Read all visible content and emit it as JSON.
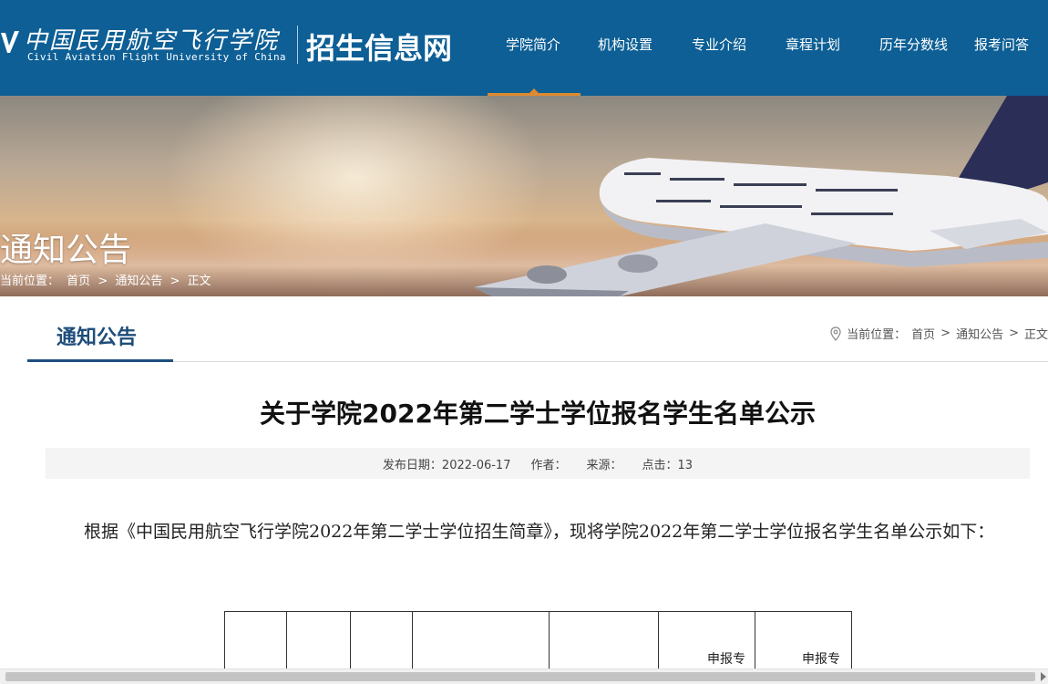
{
  "header": {
    "logo_cn": "中国民用航空飞行学院",
    "logo_en": "Civil Aviation Flight University of China",
    "site_title": "招生信息网",
    "nav": [
      {
        "label": "学院简介",
        "active": true
      },
      {
        "label": "机构设置",
        "active": false
      },
      {
        "label": "专业介绍",
        "active": false
      },
      {
        "label": "章程计划",
        "active": false
      },
      {
        "label": "历年分数线",
        "active": false
      },
      {
        "label": "报考问答",
        "active": false
      }
    ]
  },
  "banner": {
    "title": "通知公告",
    "crumb_prefix": "当前位置：",
    "crumb_home": "首页",
    "crumb_section": "通知公告",
    "crumb_current": "正文",
    "separator": ">"
  },
  "section": {
    "tab_label": "通知公告",
    "crumb_prefix": "当前位置：",
    "crumb_home": "首页",
    "crumb_section": "通知公告",
    "crumb_current": "正文",
    "separator": ">"
  },
  "article": {
    "title": "关于学院2022年第二学士学位报名学生名单公示",
    "meta": {
      "date_label": "发布日期：",
      "date": "2022-06-17",
      "author_label": "作者：",
      "source_label": "来源：",
      "clicks_label": "点击：",
      "clicks": "13"
    },
    "paragraph": "根据《中国民用航空飞行学院2022年第二学士学位招生简章》，现将学院2022年第二学士学位报名学生名单公示如下：",
    "table_headers": [
      "",
      "",
      "",
      "",
      "",
      "申报专",
      "申报专"
    ]
  },
  "colors": {
    "header_bg": "#0d5f95",
    "accent": "#e08a2e",
    "section_title": "#1e4d7a"
  }
}
